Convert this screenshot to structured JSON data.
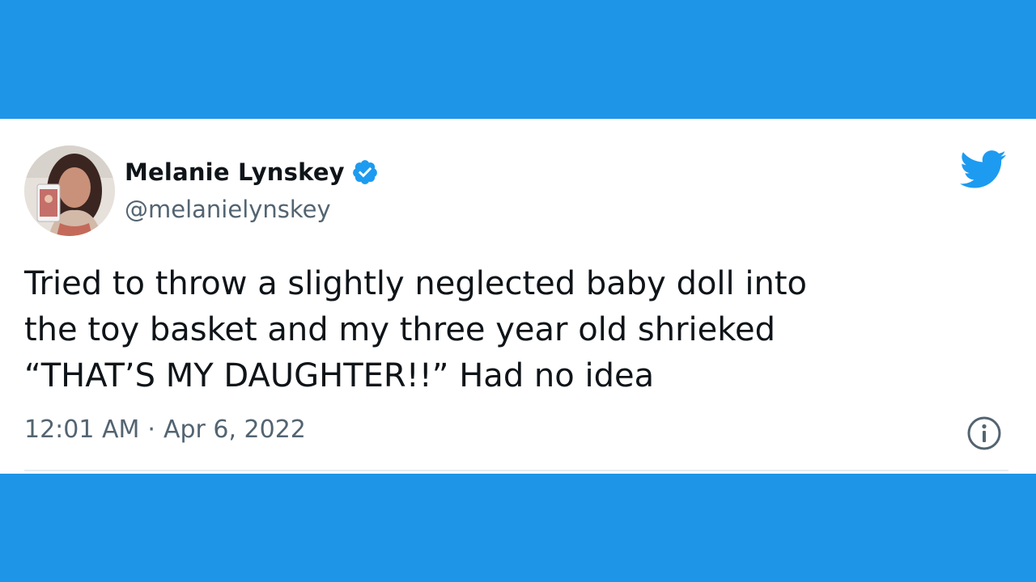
{
  "tweet": {
    "author": {
      "display_name": "Melanie Lynskey",
      "handle": "@melanielynskey",
      "verified": true,
      "avatar_icon": "profile-photo"
    },
    "text_lines": [
      "Tried to throw a slightly neglected baby doll into",
      "the toy basket and my three year old shrieked",
      "“THAT’S MY DAUGHTER!!” Had no idea"
    ],
    "time": "12:01 AM",
    "separator": "·",
    "date": "Apr 6, 2022",
    "icons": {
      "verified": "verified-badge-icon",
      "brand": "twitter-bird-icon",
      "info": "info-icon"
    }
  },
  "colors": {
    "background": "#1f95e8",
    "card": "#ffffff",
    "brand_blue": "#1d9bf0",
    "text": "#0f1419",
    "muted": "#536471"
  }
}
